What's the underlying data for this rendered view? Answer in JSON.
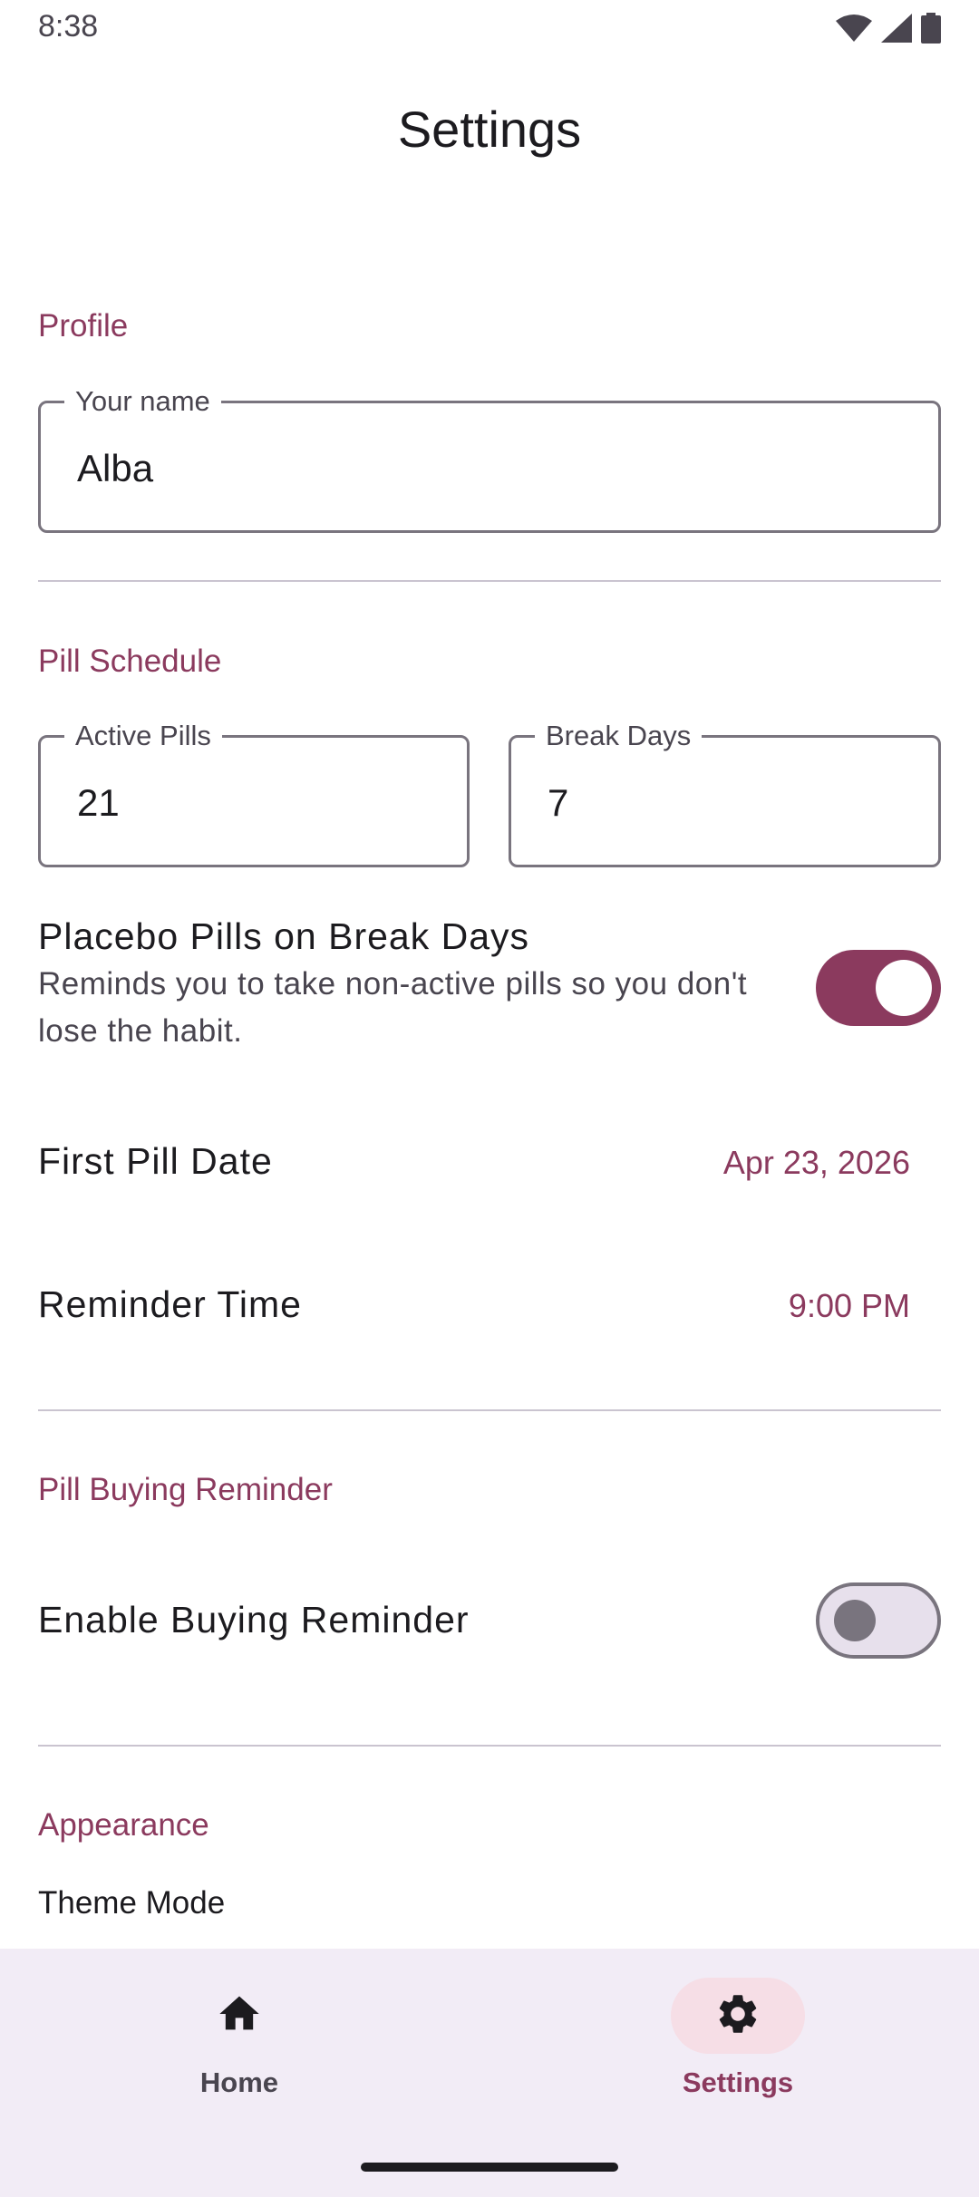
{
  "status_bar": {
    "time": "8:38",
    "icons": [
      "wifi-icon",
      "cellular-signal-icon",
      "battery-icon"
    ]
  },
  "header": {
    "title": "Settings"
  },
  "profile": {
    "section_title": "Profile",
    "name_field": {
      "label": "Your name",
      "value": "Alba"
    }
  },
  "pill_schedule": {
    "section_title": "Pill Schedule",
    "active_pills": {
      "label": "Active Pills",
      "value": "21"
    },
    "break_days": {
      "label": "Break Days",
      "value": "7"
    },
    "placebo": {
      "title": "Placebo Pills on Break Days",
      "description": "Reminds you to take non-active pills so you don't lose the habit.",
      "enabled": true
    },
    "first_pill_date": {
      "label": "First Pill Date",
      "value": "Apr 23, 2026"
    },
    "reminder_time": {
      "label": "Reminder Time",
      "value": "9:00 PM"
    }
  },
  "buying_reminder": {
    "section_title": "Pill Buying Reminder",
    "enable": {
      "label": "Enable Buying Reminder",
      "enabled": false
    }
  },
  "appearance": {
    "section_title": "Appearance",
    "theme_mode_label": "Theme Mode"
  },
  "bottom_nav": {
    "items": [
      {
        "label": "Home",
        "icon": "home-icon",
        "active": false
      },
      {
        "label": "Settings",
        "icon": "gear-icon",
        "active": true
      }
    ]
  },
  "colors": {
    "accent": "#8b3a5e",
    "nav_background": "#f2ecf6",
    "active_indicator": "#f6dee6",
    "outline": "#79747e"
  }
}
